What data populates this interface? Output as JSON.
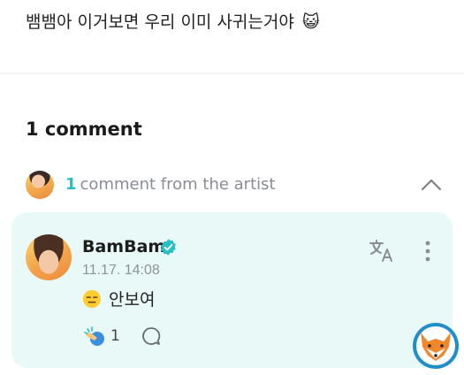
{
  "post": {
    "text": "뱀뱀아 이거보면 우리 이미 사귀는거야",
    "emoji": "😺"
  },
  "comments": {
    "count_label": "1 comment",
    "artist_summary": {
      "count": "1",
      "label": "comment from the artist"
    }
  },
  "artist_comment": {
    "author": "BamBam",
    "timestamp": "11.17. 14:08",
    "text": "안보여",
    "reaction_count": "1"
  },
  "colors": {
    "accent": "#26c0c4",
    "card_bg": "#e8f9f7",
    "muted": "#8a8d96"
  },
  "icons": {
    "chevron": "chevron-up-icon",
    "verified": "verified-badge-icon",
    "translate": "translate-icon",
    "more": "more-vertical-icon",
    "reaction": "reaction-icon",
    "reply": "reply-bubble-icon",
    "watermark": "fox-logo-icon"
  }
}
